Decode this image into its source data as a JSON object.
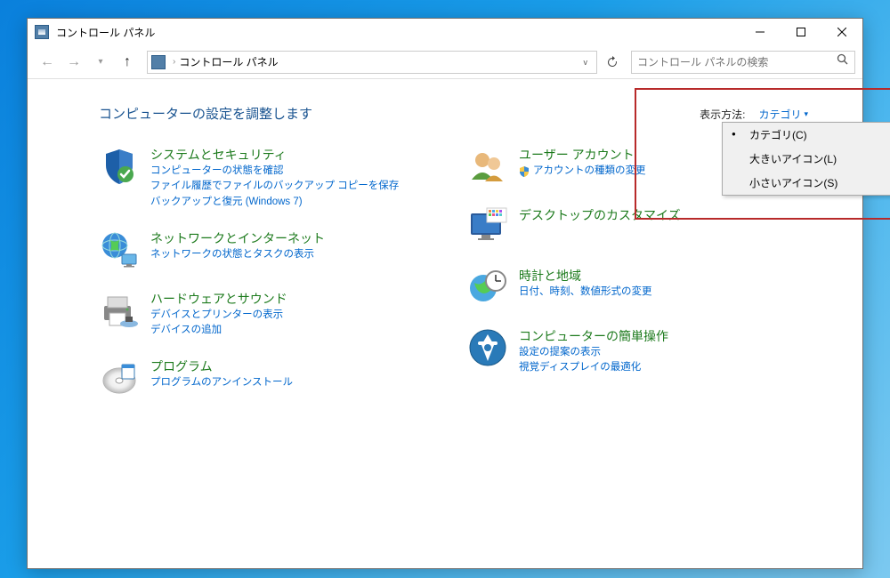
{
  "titlebar": {
    "title": "コントロール パネル"
  },
  "addrbar": {
    "crumb": "コントロール パネル",
    "search_placeholder": "コントロール パネルの検索"
  },
  "heading": "コンピューターの設定を調整します",
  "viewby": {
    "label": "表示方法:",
    "current": "カテゴリ",
    "options": [
      "カテゴリ(C)",
      "大きいアイコン(L)",
      "小さいアイコン(S)"
    ]
  },
  "cats": {
    "security": {
      "title": "システムとセキュリティ",
      "links": [
        "コンピューターの状態を確認",
        "ファイル履歴でファイルのバックアップ コピーを保存",
        "バックアップと復元 (Windows 7)"
      ]
    },
    "network": {
      "title": "ネットワークとインターネット",
      "links": [
        "ネットワークの状態とタスクの表示"
      ]
    },
    "hardware": {
      "title": "ハードウェアとサウンド",
      "links": [
        "デバイスとプリンターの表示",
        "デバイスの追加"
      ]
    },
    "programs": {
      "title": "プログラム",
      "links": [
        "プログラムのアンインストール"
      ]
    },
    "users": {
      "title": "ユーザー アカウント",
      "links": [
        "アカウントの種類の変更"
      ]
    },
    "desktop": {
      "title": "デスクトップのカスタマイズ"
    },
    "clock": {
      "title": "時計と地域",
      "links": [
        "日付、時刻、数値形式の変更"
      ]
    },
    "ease": {
      "title": "コンピューターの簡単操作",
      "links": [
        "設定の提案の表示",
        "視覚ディスプレイの最適化"
      ]
    }
  }
}
